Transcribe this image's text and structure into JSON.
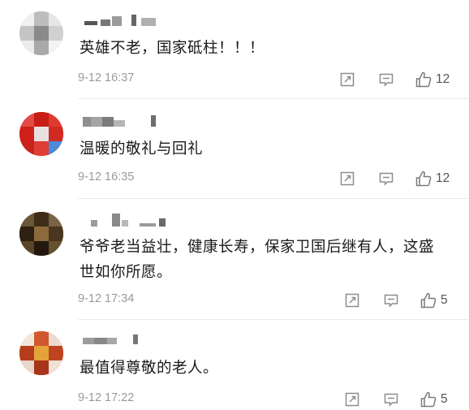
{
  "comments": [
    {
      "text": "英雄不老，国家砥柱！！！",
      "time": "9-12 16:37",
      "likes": "12"
    },
    {
      "text": "温暖的敬礼与回礼",
      "time": "9-12 16:35",
      "likes": "12"
    },
    {
      "text": "爷爷老当益壮，健康长寿，保家卫国后继有人，这盛世如你所愿。",
      "time": "9-12 17:34",
      "likes": "5"
    },
    {
      "text": "最值得尊敬的老人。",
      "time": "9-12 17:22",
      "likes": "5"
    }
  ],
  "icons": {
    "share": "share-icon",
    "reply": "comment-icon",
    "like": "thumbs-up-icon"
  }
}
